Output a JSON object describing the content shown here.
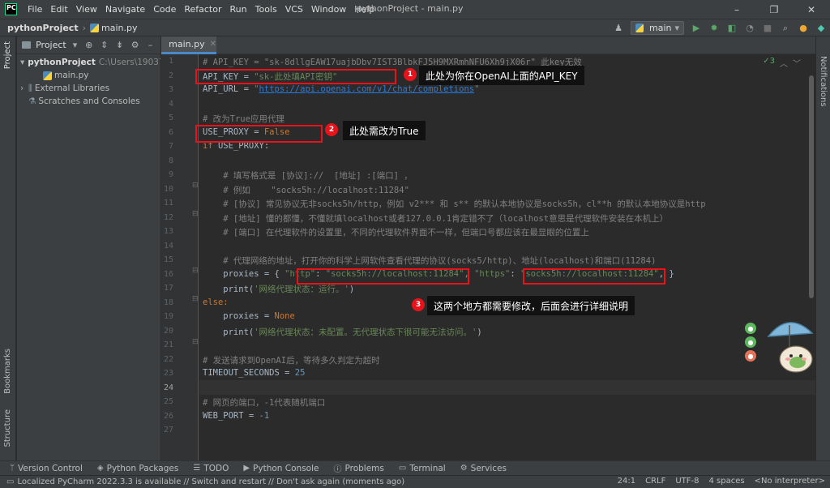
{
  "menubar": {
    "logo": "PC",
    "items": [
      "File",
      "Edit",
      "View",
      "Navigate",
      "Code",
      "Refactor",
      "Run",
      "Tools",
      "VCS",
      "Window",
      "Help"
    ],
    "window_title": "pythonProject - main.py",
    "minimize": "–",
    "maximize": "❐",
    "close": "✕"
  },
  "navbar": {
    "project": "pythonProject",
    "file": "main.py",
    "run_config": "main",
    "run_config_arrow": "▾"
  },
  "left_strip": {
    "project_label": "Project",
    "bookmarks_label": "Bookmarks",
    "structure_label": "Structure"
  },
  "right_strip": {
    "notifications_label": "Notifications"
  },
  "project_panel": {
    "title": "Project",
    "title_arrow": "▾",
    "tree": [
      {
        "label": "pythonProject",
        "path": "C:\\Users\\19037\\",
        "arrow": "▾"
      },
      {
        "label": "main.py"
      },
      {
        "label": "External Libraries",
        "arrow": "›"
      },
      {
        "label": "Scratches and Consoles"
      }
    ]
  },
  "editor": {
    "tab_label": "main.py",
    "tab_close": "✕",
    "inspection": "✓3",
    "line_numbers": [
      1,
      2,
      3,
      4,
      5,
      6,
      7,
      8,
      9,
      10,
      11,
      12,
      13,
      14,
      15,
      16,
      17,
      18,
      19,
      20,
      21,
      22,
      23,
      24,
      25,
      26,
      27
    ],
    "code": {
      "l1a": "# API_KEY = \"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\" ",
      "l1b": "此key无效",
      "l2a": "API_KEY = ",
      "l2b": "\"sk-此处填API密钥\"",
      "l3a": "API_URL = ",
      "l3q1": "\"",
      "l3url": "https://api.openai.com/v1/chat/completions",
      "l3q2": "\"",
      "l5": "# 改为True应用代理",
      "l6a": "USE_PROXY = ",
      "l6b": "False",
      "l7a": "if",
      "l7b": " USE_PROXY:",
      "l9": "    # 填写格式是 [协议]://  [地址] :[端口] ，",
      "l10": "    # 例如    \"socks5h://localhost:11284\"",
      "l11": "    # [协议] 常见协议无非socks5h/http，例如 v2*** 和 s** 的默认本地协议是socks5h，cl**h 的默认本地协议是http",
      "l12": "    # [地址] 懂的都懂，不懂就填localhost或者127.0.0.1肯定错不了（localhost意思是代理软件安装在本机上）",
      "l13": "    # [端口] 在代理软件的设置里，不同的代理软件界面不一样，但端口号都应该在最显眼的位置上",
      "l15": "    # 代理网络的地址，打开你的科学上网软件查看代理的协议(socks5/http)、地址(localhost)和端口(11284)",
      "l16a": "    proxies = { ",
      "l16b": "\"http\"",
      "l16c": ": ",
      "l16d": "\"socks5h://localhost:11284\"",
      "l16e": ", ",
      "l16f": "\"https\"",
      "l16g": ": ",
      "l16h": "\"socks5h://localhost:11284\"",
      "l16i": ", }",
      "l17a": "    print(",
      "l17b": "'网络代理状态：运行。'",
      "l17c": ")",
      "l18": "else:",
      "l19a": "    proxies = ",
      "l19b": "None",
      "l20a": "    print(",
      "l20b": "'网络代理状态：未配置。无代理状态下很可能无法访问。'",
      "l20c": ")",
      "l22": "# 发送请求到OpenAI后，等待多久判定为超时",
      "l23a": "TIMEOUT_SECONDS = ",
      "l23b": "25",
      "l25": "# 网页的端口，-1代表随机端口",
      "l26a": "WEB_PORT = ",
      "l26b": "-1"
    }
  },
  "annotations": {
    "n1": "1",
    "t1": "此处为你在OpenAI上面的API_KEY",
    "n2": "2",
    "t2": "此处需改为True",
    "n3": "3",
    "t3": "这两个地方都需要修改，后面会进行详细说明"
  },
  "bottom_tools": [
    {
      "icon": "ᛘ",
      "label": "Version Control"
    },
    {
      "icon": "◈",
      "label": "Python Packages"
    },
    {
      "icon": "☰",
      "label": "TODO"
    },
    {
      "icon": "▶",
      "label": "Python Console"
    },
    {
      "icon": "ⓘ",
      "label": "Problems"
    },
    {
      "icon": "▭",
      "label": "Terminal"
    },
    {
      "icon": "⚙",
      "label": "Services"
    }
  ],
  "statusbar": {
    "message": "Localized PyCharm 2022.3.3 is available // Switch and restart // Don't ask again (moments ago)",
    "position": "24:1",
    "line_sep": "CRLF",
    "encoding": "UTF-8",
    "indent": "4 spaces",
    "interpreter": "<No interpreter>"
  },
  "colors": {
    "accent": "#4a88c7",
    "annotation": "#e8131a",
    "keyword": "#cc7832",
    "string": "#6a8759",
    "comment": "#808080"
  }
}
